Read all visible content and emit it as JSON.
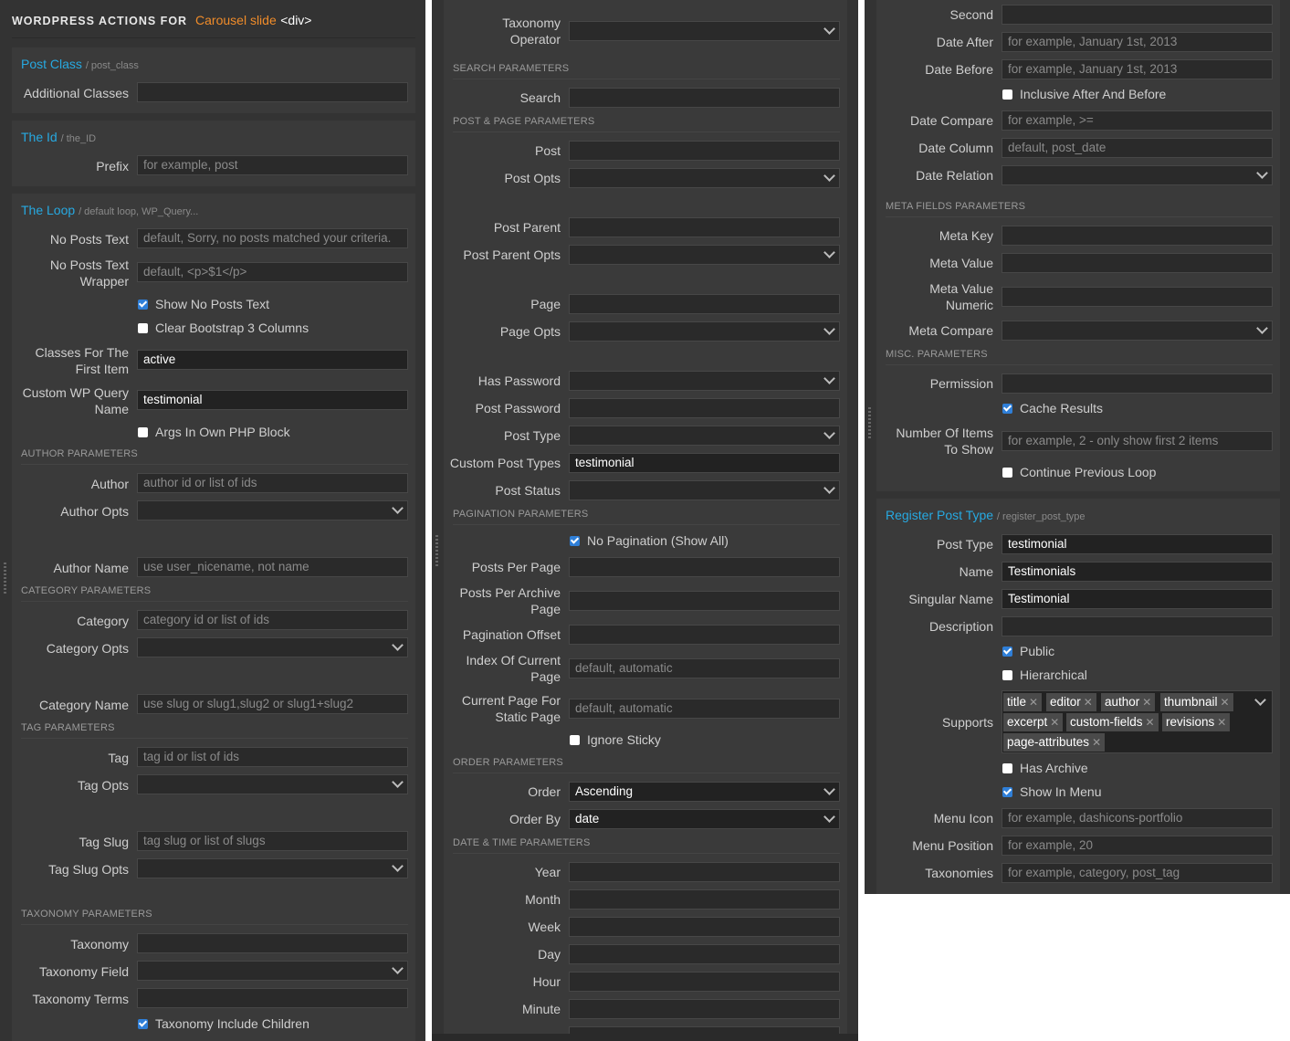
{
  "col1": {
    "header": {
      "prefix": "WORDPRESS ACTIONS FOR",
      "accent": "Carousel slide",
      "tag": "<div>"
    },
    "post_class": {
      "title": "Post Class",
      "sub": "/ post_class",
      "additional_classes_label": "Additional Classes",
      "additional_classes_value": ""
    },
    "the_id": {
      "title": "The Id",
      "sub": "/ the_ID",
      "prefix_label": "Prefix",
      "prefix_placeholder": "for example, post"
    },
    "loop": {
      "title": "The Loop",
      "sub": "/ default loop, WP_Query...",
      "no_posts_text_label": "No Posts Text",
      "no_posts_text_placeholder": "default, Sorry, no posts matched your criteria.",
      "no_posts_wrapper_label_1": "No Posts Text",
      "no_posts_wrapper_label_2": "Wrapper",
      "no_posts_wrapper_placeholder": "default, <p>$1</p>",
      "show_no_posts_text": "Show No Posts Text",
      "clear_bootstrap": "Clear Bootstrap 3 Columns",
      "classes_first_label_1": "Classes For The",
      "classes_first_label_2": "First Item",
      "classes_first_value": "active",
      "custom_wp_query_label_1": "Custom WP Query",
      "custom_wp_query_label_2": "Name",
      "custom_wp_query_value": "testimonial",
      "args_own_php": "Args In Own PHP Block"
    },
    "author": {
      "section": "AUTHOR PARAMETERS",
      "author_label": "Author",
      "author_placeholder": "author id or list of ids",
      "opts_label": "Author Opts",
      "name_label": "Author Name",
      "name_placeholder": "use user_nicename, not name"
    },
    "category": {
      "section": "CATEGORY PARAMETERS",
      "label": "Category",
      "placeholder": "category id or list of ids",
      "opts_label": "Category Opts",
      "name_label": "Category Name",
      "name_placeholder": "use slug or slug1,slug2 or slug1+slug2"
    },
    "tag": {
      "section": "TAG PARAMETERS",
      "label": "Tag",
      "placeholder": "tag id or list of ids",
      "opts_label": "Tag Opts",
      "slug_label": "Tag Slug",
      "slug_placeholder": "tag slug or list of slugs",
      "slug_opts_label": "Tag Slug Opts"
    },
    "taxonomy": {
      "section": "TAXONOMY PARAMETERS",
      "label": "Taxonomy",
      "field_label": "Taxonomy Field",
      "terms_label": "Taxonomy Terms",
      "include_children": "Taxonomy Include Children"
    }
  },
  "col2": {
    "taxonomy_operator_1": "Taxonomy",
    "taxonomy_operator_2": "Operator",
    "search": {
      "section": "SEARCH PARAMETERS",
      "label": "Search"
    },
    "post_page": {
      "section": "POST & PAGE PARAMETERS",
      "post": "Post",
      "post_opts": "Post Opts",
      "post_parent": "Post Parent",
      "post_parent_opts": "Post Parent Opts",
      "page": "Page",
      "page_opts": "Page Opts",
      "has_password": "Has Password",
      "post_password": "Post Password",
      "post_type": "Post Type",
      "custom_post_types": "Custom Post Types",
      "custom_post_types_value": "testimonial",
      "post_status": "Post Status"
    },
    "pagination": {
      "section": "PAGINATION PARAMETERS",
      "no_pagination": "No Pagination (Show All)",
      "posts_per_page": "Posts Per Page",
      "per_archive_1": "Posts Per Archive",
      "per_archive_2": "Page",
      "offset": "Pagination Offset",
      "index_current_1": "Index Of Current",
      "index_current_2": "Page",
      "index_current_placeholder": "default, automatic",
      "current_static_1": "Current Page For",
      "current_static_2": "Static Page",
      "current_static_placeholder": "default, automatic",
      "ignore_sticky": "Ignore Sticky"
    },
    "order": {
      "section": "ORDER PARAMETERS",
      "order_label": "Order",
      "order_value": "Ascending",
      "order_by_label": "Order By",
      "order_by_value": "date"
    },
    "datetime": {
      "section": "DATE & TIME PARAMETERS",
      "year": "Year",
      "month": "Month",
      "week": "Week",
      "day": "Day",
      "hour": "Hour",
      "minute": "Minute"
    }
  },
  "col3": {
    "second": "Second",
    "date_after": "Date After",
    "date_after_placeholder": "for example, January 1st, 2013",
    "date_before": "Date Before",
    "date_before_placeholder": "for example, January 1st, 2013",
    "inclusive": "Inclusive After And Before",
    "date_compare": "Date Compare",
    "date_compare_placeholder": "for example, >=",
    "date_column": "Date Column",
    "date_column_placeholder": "default, post_date",
    "date_relation": "Date Relation",
    "meta": {
      "section": "META FIELDS PARAMETERS",
      "key": "Meta Key",
      "value": "Meta Value",
      "numeric_1": "Meta Value",
      "numeric_2": "Numeric",
      "compare": "Meta Compare"
    },
    "misc": {
      "section": "MISC. PARAMETERS",
      "permission": "Permission",
      "cache": "Cache Results",
      "num_items_1": "Number Of Items",
      "num_items_2": "To Show",
      "num_items_placeholder": "for example, 2 - only show first 2 items",
      "continue_loop": "Continue Previous Loop"
    },
    "register": {
      "title": "Register Post Type",
      "sub": "/ register_post_type",
      "post_type_label": "Post Type",
      "post_type_value": "testimonial",
      "name_label": "Name",
      "name_value": "Testimonials",
      "singular_label": "Singular Name",
      "singular_value": "Testimonial",
      "description_label": "Description",
      "public": "Public",
      "hierarchical": "Hierarchical",
      "supports_label": "Supports",
      "supports": [
        "title",
        "editor",
        "author",
        "thumbnail",
        "excerpt",
        "custom-fields",
        "revisions",
        "page-attributes"
      ],
      "has_archive": "Has Archive",
      "show_in_menu": "Show In Menu",
      "menu_icon_label": "Menu Icon",
      "menu_icon_placeholder": "for example, dashicons-portfolio",
      "menu_position_label": "Menu Position",
      "menu_position_placeholder": "for example, 20",
      "taxonomies_label": "Taxonomies",
      "taxonomies_placeholder": "for example, category, post_tag"
    }
  }
}
